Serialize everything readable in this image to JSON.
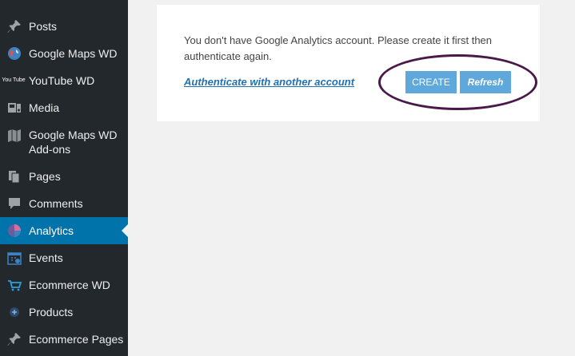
{
  "sidebar": {
    "items": [
      {
        "label": "Posts",
        "icon": "pushpin-icon"
      },
      {
        "label": "Google Maps WD",
        "icon": "globe-icon"
      },
      {
        "label": "YouTube WD",
        "icon": "youtube-icon",
        "icon_text": "You Tube"
      },
      {
        "label": "Media",
        "icon": "media-icon"
      },
      {
        "label": "Google Maps WD",
        "label2": "Add-ons",
        "icon": "map-addons-icon"
      },
      {
        "label": "Pages",
        "icon": "pages-icon"
      },
      {
        "label": "Comments",
        "icon": "comment-icon"
      },
      {
        "label": "Analytics",
        "icon": "analytics-icon",
        "active": true
      },
      {
        "label": "Events",
        "icon": "calendar-icon"
      },
      {
        "label": "Ecommerce WD",
        "icon": "cart-icon"
      },
      {
        "label": "Products",
        "icon": "products-icon"
      },
      {
        "label": "Ecommerce Pages",
        "icon": "pushpin-icon"
      }
    ]
  },
  "main": {
    "message": "You don't have Google Analytics account. Please create it first then authenticate again.",
    "auth_link": "Authenticate with another account",
    "create_label": "CREATE",
    "refresh_label": "Refresh"
  },
  "colors": {
    "sidebar_bg": "#23282d",
    "active_bg": "#0073aa",
    "button_bg": "#5fa8dc",
    "link": "#2271b1",
    "highlight_ring": "#4a1949"
  }
}
